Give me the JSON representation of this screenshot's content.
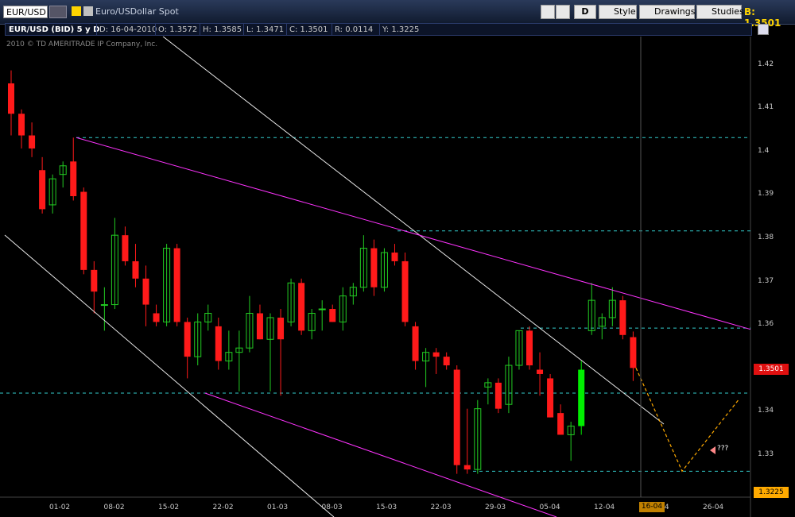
{
  "toolbar": {
    "symbol": "EUR/USD",
    "description": "Euro/USDollar Spot",
    "period_button": "D",
    "style_label": "Style",
    "drawings_label": "Drawings",
    "studies_label": "Studies",
    "bid_label": "B: 1.3501"
  },
  "info": {
    "instrument": "EUR/USD (BID) 5 y D",
    "date": "D: 16-04-2010",
    "open": "O: 1.3572",
    "high": "H: 1.3585",
    "low": "L: 1.3471",
    "close": "C: 1.3501",
    "range": "R: 0.0114",
    "y": "Y: 1.3225"
  },
  "copyright": "2010 © TD AMERITRADE IP Company, Inc.",
  "price_tag": "1.3501",
  "y_tag": "1.3225",
  "date_tag": "16-04",
  "annotation": "???",
  "colors": {
    "up": "#22cc22",
    "down": "#ff1a1a",
    "last_up": "#00ee00",
    "channel": "#e8e8e8",
    "trend": "#ff33ff",
    "level": "#33cccc",
    "projection": "#ffaa00"
  },
  "chart_data": {
    "type": "candlestick",
    "ylim": [
      1.3205,
      1.4265
    ],
    "y_ticks": [
      "1.42",
      "1.41",
      "1.4",
      "1.39",
      "1.38",
      "1.37",
      "1.36",
      "1.35",
      "1.34",
      "1.33"
    ],
    "x_ticks": [
      "01-02",
      "08-02",
      "15-02",
      "22-02",
      "01-03",
      "08-03",
      "15-03",
      "22-03",
      "29-03",
      "05-04",
      "12-04",
      "19-04",
      "26-04"
    ],
    "levels": [
      1.4032,
      1.3817,
      1.3593,
      1.3443,
      1.3263
    ],
    "candles": [
      {
        "o": 1.4157,
        "h": 1.4187,
        "l": 1.4037,
        "c": 1.4087
      },
      {
        "o": 1.4087,
        "h": 1.4097,
        "l": 1.4007,
        "c": 1.4037
      },
      {
        "o": 1.4037,
        "h": 1.4067,
        "l": 1.3987,
        "c": 1.4007
      },
      {
        "o": 1.3957,
        "h": 1.3987,
        "l": 1.3857,
        "c": 1.3867
      },
      {
        "o": 1.3877,
        "h": 1.3947,
        "l": 1.3857,
        "c": 1.3937
      },
      {
        "o": 1.3947,
        "h": 1.3977,
        "l": 1.3917,
        "c": 1.3967
      },
      {
        "o": 1.3977,
        "h": 1.4032,
        "l": 1.3887,
        "c": 1.3897
      },
      {
        "o": 1.3907,
        "h": 1.3917,
        "l": 1.3717,
        "c": 1.3727
      },
      {
        "o": 1.3727,
        "h": 1.3747,
        "l": 1.3627,
        "c": 1.3677
      },
      {
        "o": 1.3647,
        "h": 1.3687,
        "l": 1.3587,
        "c": 1.3647
      },
      {
        "o": 1.3647,
        "h": 1.3847,
        "l": 1.3637,
        "c": 1.3807
      },
      {
        "o": 1.3807,
        "h": 1.3827,
        "l": 1.3737,
        "c": 1.3747
      },
      {
        "o": 1.3747,
        "h": 1.3787,
        "l": 1.3687,
        "c": 1.3707
      },
      {
        "o": 1.3707,
        "h": 1.3737,
        "l": 1.3597,
        "c": 1.3647
      },
      {
        "o": 1.3627,
        "h": 1.3647,
        "l": 1.3597,
        "c": 1.3607
      },
      {
        "o": 1.3607,
        "h": 1.3787,
        "l": 1.3597,
        "c": 1.3777
      },
      {
        "o": 1.3777,
        "h": 1.3787,
        "l": 1.3597,
        "c": 1.3607
      },
      {
        "o": 1.3607,
        "h": 1.3617,
        "l": 1.3477,
        "c": 1.3527
      },
      {
        "o": 1.3527,
        "h": 1.3627,
        "l": 1.3507,
        "c": 1.3607
      },
      {
        "o": 1.3607,
        "h": 1.3647,
        "l": 1.3587,
        "c": 1.3627
      },
      {
        "o": 1.3597,
        "h": 1.3617,
        "l": 1.3497,
        "c": 1.3517
      },
      {
        "o": 1.3517,
        "h": 1.3587,
        "l": 1.3497,
        "c": 1.3537
      },
      {
        "o": 1.3537,
        "h": 1.3587,
        "l": 1.3447,
        "c": 1.3547
      },
      {
        "o": 1.3547,
        "h": 1.3667,
        "l": 1.3537,
        "c": 1.3627
      },
      {
        "o": 1.3627,
        "h": 1.3647,
        "l": 1.3567,
        "c": 1.3567
      },
      {
        "o": 1.3567,
        "h": 1.3627,
        "l": 1.3447,
        "c": 1.3617
      },
      {
        "o": 1.3617,
        "h": 1.3637,
        "l": 1.3437,
        "c": 1.3567
      },
      {
        "o": 1.3607,
        "h": 1.3707,
        "l": 1.3597,
        "c": 1.3697
      },
      {
        "o": 1.3697,
        "h": 1.3707,
        "l": 1.3577,
        "c": 1.3587
      },
      {
        "o": 1.3587,
        "h": 1.3637,
        "l": 1.3567,
        "c": 1.3627
      },
      {
        "o": 1.3637,
        "h": 1.3657,
        "l": 1.3587,
        "c": 1.3637
      },
      {
        "o": 1.3637,
        "h": 1.3647,
        "l": 1.3607,
        "c": 1.3607
      },
      {
        "o": 1.3607,
        "h": 1.3687,
        "l": 1.3587,
        "c": 1.3667
      },
      {
        "o": 1.3667,
        "h": 1.3697,
        "l": 1.3647,
        "c": 1.3687
      },
      {
        "o": 1.3687,
        "h": 1.3807,
        "l": 1.3677,
        "c": 1.3777
      },
      {
        "o": 1.3777,
        "h": 1.3797,
        "l": 1.3667,
        "c": 1.3687
      },
      {
        "o": 1.3687,
        "h": 1.3777,
        "l": 1.3677,
        "c": 1.3767
      },
      {
        "o": 1.3767,
        "h": 1.3787,
        "l": 1.3737,
        "c": 1.3747
      },
      {
        "o": 1.3747,
        "h": 1.3767,
        "l": 1.3597,
        "c": 1.3607
      },
      {
        "o": 1.3597,
        "h": 1.3607,
        "l": 1.3497,
        "c": 1.3517
      },
      {
        "o": 1.3517,
        "h": 1.3547,
        "l": 1.3457,
        "c": 1.3537
      },
      {
        "o": 1.3537,
        "h": 1.3547,
        "l": 1.3487,
        "c": 1.3527
      },
      {
        "o": 1.3527,
        "h": 1.3537,
        "l": 1.3497,
        "c": 1.3507
      },
      {
        "o": 1.3497,
        "h": 1.3507,
        "l": 1.3257,
        "c": 1.3277
      },
      {
        "o": 1.3277,
        "h": 1.3407,
        "l": 1.3257,
        "c": 1.3267
      },
      {
        "o": 1.3267,
        "h": 1.3427,
        "l": 1.3257,
        "c": 1.3407
      },
      {
        "o": 1.3457,
        "h": 1.3477,
        "l": 1.3417,
        "c": 1.3467
      },
      {
        "o": 1.3467,
        "h": 1.3477,
        "l": 1.3397,
        "c": 1.3407
      },
      {
        "o": 1.3417,
        "h": 1.3527,
        "l": 1.3397,
        "c": 1.3507
      },
      {
        "o": 1.3507,
        "h": 1.3587,
        "l": 1.3497,
        "c": 1.3587
      },
      {
        "o": 1.3587,
        "h": 1.3597,
        "l": 1.3497,
        "c": 1.3507
      },
      {
        "o": 1.3497,
        "h": 1.3537,
        "l": 1.3437,
        "c": 1.3487
      },
      {
        "o": 1.3477,
        "h": 1.3487,
        "l": 1.3387,
        "c": 1.3387
      },
      {
        "o": 1.3397,
        "h": 1.3417,
        "l": 1.3347,
        "c": 1.3347
      },
      {
        "o": 1.3347,
        "h": 1.3377,
        "l": 1.3287,
        "c": 1.3367
      },
      {
        "o": 1.3367,
        "h": 1.3517,
        "l": 1.3347,
        "c": 1.3497
      },
      {
        "o": 1.3587,
        "h": 1.3697,
        "l": 1.3577,
        "c": 1.3657
      },
      {
        "o": 1.3597,
        "h": 1.3627,
        "l": 1.3567,
        "c": 1.3617
      },
      {
        "o": 1.3617,
        "h": 1.3687,
        "l": 1.3597,
        "c": 1.3657
      },
      {
        "o": 1.3657,
        "h": 1.3667,
        "l": 1.3567,
        "c": 1.3577
      },
      {
        "o": 1.3572,
        "h": 1.3585,
        "l": 1.3471,
        "c": 1.3501
      }
    ]
  }
}
